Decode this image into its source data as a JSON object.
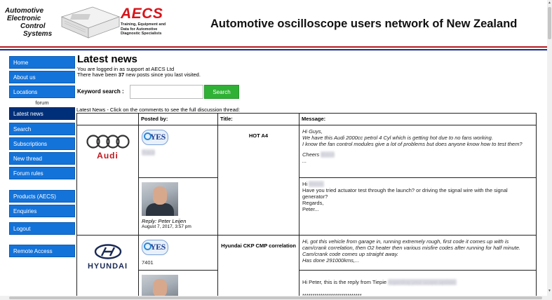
{
  "header": {
    "logo_lines": [
      "Automotive",
      "Electronic",
      "Control",
      "Systems"
    ],
    "brand": "AECS",
    "brand_tagline": [
      "Training, Equipment and",
      "Data for Automotive",
      "Diagnostic Specialists"
    ],
    "site_title": "Automotive oscilloscope users network of New Zealand",
    "stripe_red": "#b41a1f",
    "stripe_blue": "#1b2e8c"
  },
  "sidebar": {
    "items": [
      {
        "label": "Home"
      },
      {
        "label": "About us"
      },
      {
        "label": "Locations"
      },
      {
        "label": "forum"
      },
      {
        "label": "Latest news"
      },
      {
        "label": "Search"
      },
      {
        "label": "Subscriptions"
      },
      {
        "label": "New thread"
      },
      {
        "label": "Forum rules"
      },
      {
        "label": "Products (AECS)"
      },
      {
        "label": "Enquiries"
      },
      {
        "label": "Logout"
      },
      {
        "label": "Remote Access"
      }
    ],
    "active": "Latest news",
    "color": "#1473d9",
    "active_color": "#002f7a"
  },
  "main": {
    "title": "Latest news",
    "login_text": "You are logged in as support at AECS Ltd",
    "posts_prefix": "There have been ",
    "posts_count": "37",
    "posts_suffix": " new posts since you last visited.",
    "keyword_label": "Keyword search :",
    "keyword_value": "",
    "search_button": "Search",
    "intro": "Latest News - Click on the comments to see the full discussion thread:",
    "table": {
      "headers": [
        "",
        "Posted by:",
        "Title:",
        "Message:"
      ],
      "threads": [
        {
          "brand": "Audi",
          "title": "HOT A4",
          "post": {
            "poster_badge": "YES",
            "poster_name_blurred": "Trace",
            "message_lines": [
              "Hi Guys,",
              "We have this Audi 2000cc petrol 4 Cyl which is getting hot due to no fans working.",
              "I know the fan control modules give a lot of problems but does anyone know how to test them?",
              "Cheers",
              "..."
            ],
            "signoff_blurred": "Brenn"
          },
          "reply": {
            "reply_by": "Reply: Peter Leijen",
            "date": "August 7, 2017, 3:57 pm",
            "greeting_prefix": "Hi ",
            "greeting_blurred": "Brenn,",
            "message_lines": [
              "Have you tried actuator test through the launch? or driving the signal wire with the signal generator?",
              "Regards,",
              "Peter..."
            ]
          }
        },
        {
          "brand": "HYUNDAI",
          "title": "Hyundai CKP CMP correlation",
          "post": {
            "poster_badge": "YES",
            "poster_id": "7401",
            "message_lines": [
              "Hi, got this vehicle from garage in, running extremely rough, first code it comes up with is cam/crank correlation, then O2 heater then various misfire codes after running for half minute. Cam/crank code comes up straight away.",
              "Has done 291000kms,..."
            ]
          },
          "reply": {
            "message_prefix": "Hi Peter, this is the reply from Tiepie",
            "message_blurred": "regarding your scope update.",
            "trailer": "*****************************"
          }
        }
      ]
    }
  }
}
